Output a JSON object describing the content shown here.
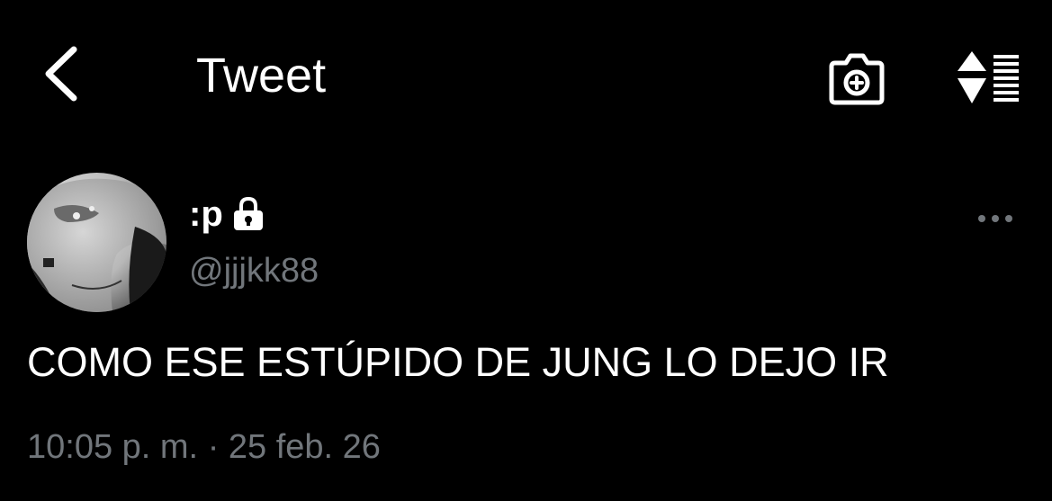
{
  "colors": {
    "background": "#000000",
    "text_primary": "#ffffff",
    "text_secondary": "#71767b"
  },
  "header": {
    "back_icon": "chevron-left-icon",
    "title": "Tweet",
    "camera_icon": "camera-plus-icon",
    "sort_icon": "sort-list-icon"
  },
  "tweet": {
    "display_name": ":p",
    "protected_icon": "lock-icon",
    "handle": "@jjjkk88",
    "more_icon": "more-horizontal-icon",
    "text": "COMO ESE ESTÚPIDO DE JUNG LO DEJO IR",
    "time": "10:05 p. m.",
    "separator": "·",
    "date": "25 feb. 26"
  }
}
